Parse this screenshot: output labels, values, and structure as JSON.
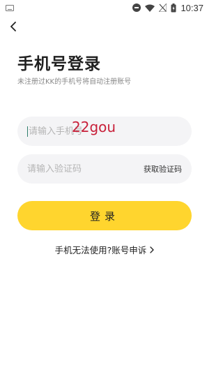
{
  "status_bar": {
    "time": "10:37",
    "icons": [
      "keyboard-icon",
      "do-not-disturb-icon",
      "wifi-icon",
      "no-signal-icon",
      "battery-charging-icon"
    ]
  },
  "header": {
    "back_icon": "chevron-left-icon"
  },
  "title": "手机号登录",
  "subtitle": "未注册过KK的手机号将自动注册账号",
  "phone_field": {
    "value": "",
    "placeholder": "请输入手机号"
  },
  "watermark": "22gou",
  "code_field": {
    "value": "",
    "placeholder": "请输入验证码",
    "get_code_label": "获取验证码"
  },
  "login_button": {
    "label": "登录",
    "color": "#ffd52e"
  },
  "appeal_link": {
    "label": "手机无法使用?账号申诉",
    "icon": "chevron-right-icon"
  }
}
